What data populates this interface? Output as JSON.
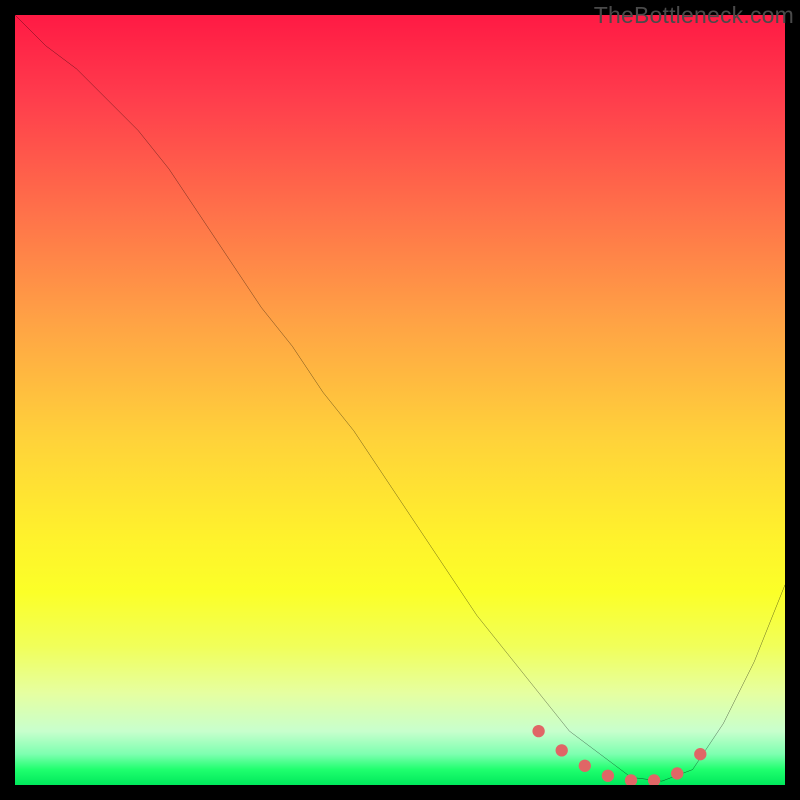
{
  "watermark": "TheBottleneck.com",
  "chart_data": {
    "type": "line",
    "title": "",
    "xlabel": "",
    "ylabel": "",
    "xlim": [
      0,
      100
    ],
    "ylim": [
      0,
      100
    ],
    "series": [
      {
        "name": "curve",
        "x": [
          0,
          4,
          8,
          12,
          16,
          20,
          24,
          28,
          32,
          36,
          40,
          44,
          48,
          52,
          56,
          60,
          64,
          68,
          72,
          76,
          80,
          84,
          88,
          92,
          96,
          100
        ],
        "y": [
          100,
          96,
          93,
          89,
          85,
          80,
          74,
          68,
          62,
          57,
          51,
          46,
          40,
          34,
          28,
          22,
          17,
          12,
          7,
          4,
          1,
          0.5,
          2,
          8,
          16,
          26
        ]
      },
      {
        "name": "dotted-valley",
        "x": [
          68,
          71,
          74,
          77,
          80,
          83,
          86,
          89
        ],
        "y": [
          7,
          4.5,
          2.5,
          1.2,
          0.6,
          0.6,
          1.5,
          4
        ]
      }
    ],
    "colors": {
      "curve": "#000000",
      "dots": "#e06666"
    }
  }
}
